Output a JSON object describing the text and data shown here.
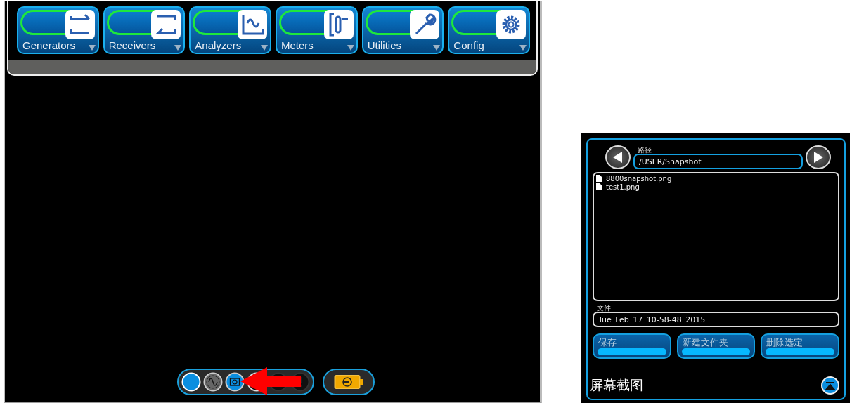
{
  "menu": [
    {
      "label": "Generators",
      "kind": "generator"
    },
    {
      "label": "Receivers",
      "kind": "receiver"
    },
    {
      "label": "Analyzers",
      "kind": "analyzer"
    },
    {
      "label": "Meters",
      "kind": "meter"
    },
    {
      "label": "Utilities",
      "kind": "wrench"
    },
    {
      "label": "Config",
      "kind": "gear"
    }
  ],
  "status_tray": [
    {
      "kind": "dot",
      "highlighted": true
    },
    {
      "kind": "wave",
      "highlighted": false
    },
    {
      "kind": "camera",
      "highlighted": true
    },
    {
      "kind": "ring",
      "highlighted": false
    },
    {
      "kind": "ring",
      "highlighted": false
    },
    {
      "kind": "alert",
      "highlighted": false
    }
  ],
  "battery": {
    "kind": "charging"
  },
  "snapshot_panel": {
    "path_label": "路径",
    "path": "/USER/Snapshot",
    "files": [
      {
        "name": "8800snapshot.png"
      },
      {
        "name": "test1.png"
      }
    ],
    "file_label": "文件",
    "file_name": "Tue_Feb_17_10-58-48_2015",
    "buttons": [
      "保存",
      "新建文件夹",
      "删除选定"
    ],
    "title": "屏幕截图"
  }
}
